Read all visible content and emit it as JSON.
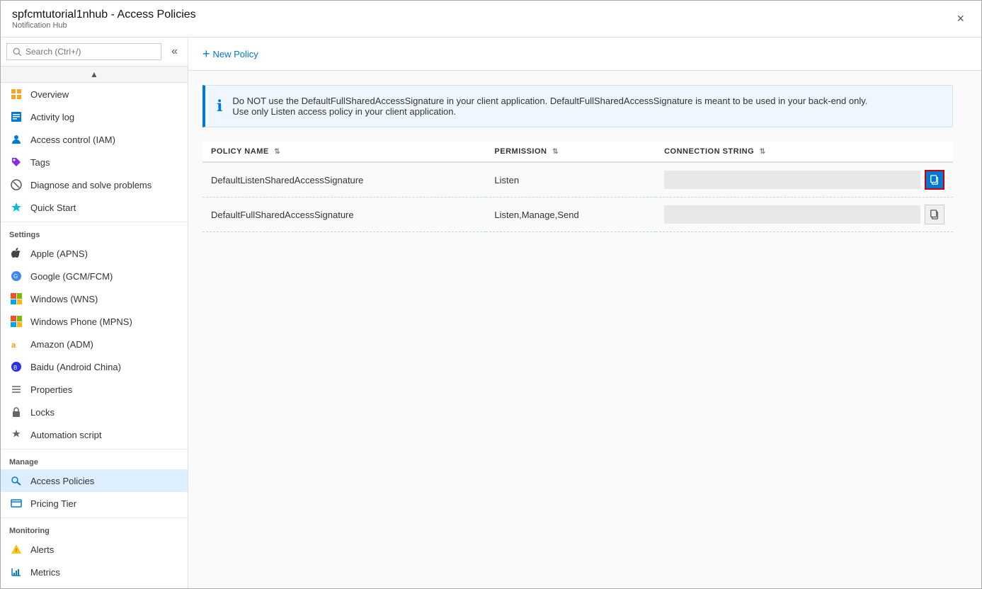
{
  "titleBar": {
    "title": "spfcmtutorial1nhub - Access Policies",
    "subtitle": "Notification Hub",
    "closeLabel": "×"
  },
  "sidebar": {
    "searchPlaceholder": "Search (Ctrl+/)",
    "collapseIcon": "«",
    "scrollUpIcon": "▲",
    "navItems": [
      {
        "id": "overview",
        "label": "Overview",
        "icon": "overview"
      },
      {
        "id": "activity-log",
        "label": "Activity log",
        "icon": "activity"
      },
      {
        "id": "access-control",
        "label": "Access control (IAM)",
        "icon": "iam"
      },
      {
        "id": "tags",
        "label": "Tags",
        "icon": "tags"
      },
      {
        "id": "diagnose",
        "label": "Diagnose and solve problems",
        "icon": "diagnose"
      },
      {
        "id": "quick-start",
        "label": "Quick Start",
        "icon": "quickstart"
      }
    ],
    "sections": [
      {
        "label": "Settings",
        "items": [
          {
            "id": "apple",
            "label": "Apple (APNS)",
            "icon": "apple"
          },
          {
            "id": "google",
            "label": "Google (GCM/FCM)",
            "icon": "google"
          },
          {
            "id": "windows",
            "label": "Windows (WNS)",
            "icon": "windows"
          },
          {
            "id": "windowsphone",
            "label": "Windows Phone (MPNS)",
            "icon": "windowsphone"
          },
          {
            "id": "amazon",
            "label": "Amazon (ADM)",
            "icon": "amazon"
          },
          {
            "id": "baidu",
            "label": "Baidu (Android China)",
            "icon": "baidu"
          },
          {
            "id": "properties",
            "label": "Properties",
            "icon": "properties"
          },
          {
            "id": "locks",
            "label": "Locks",
            "icon": "locks"
          },
          {
            "id": "automation",
            "label": "Automation script",
            "icon": "automation"
          }
        ]
      },
      {
        "label": "Manage",
        "items": [
          {
            "id": "access-policies",
            "label": "Access Policies",
            "icon": "key",
            "active": true
          },
          {
            "id": "pricing-tier",
            "label": "Pricing Tier",
            "icon": "pricing"
          }
        ]
      },
      {
        "label": "Monitoring",
        "items": [
          {
            "id": "alerts",
            "label": "Alerts",
            "icon": "alerts"
          },
          {
            "id": "metrics",
            "label": "Metrics",
            "icon": "metrics"
          }
        ]
      }
    ]
  },
  "toolbar": {
    "newPolicyIcon": "+",
    "newPolicyLabel": "New Policy"
  },
  "infoBox": {
    "icon": "ℹ",
    "line1": "Do NOT use the DefaultFullSharedAccessSignature in your client application.  DefaultFullSharedAccessSignature is meant to be used in your back-end only.",
    "line2": "Use only Listen access policy in your client application."
  },
  "table": {
    "columns": [
      {
        "id": "policy-name",
        "label": "POLICY NAME"
      },
      {
        "id": "permission",
        "label": "PERMISSION"
      },
      {
        "id": "connection-string",
        "label": "CONNECTION STRING"
      }
    ],
    "rows": [
      {
        "policyName": "DefaultListenSharedAccessSignature",
        "permission": "Listen",
        "connectionString": ""
      },
      {
        "policyName": "DefaultFullSharedAccessSignature",
        "permission": "Listen,Manage,Send",
        "connectionString": ""
      }
    ]
  }
}
